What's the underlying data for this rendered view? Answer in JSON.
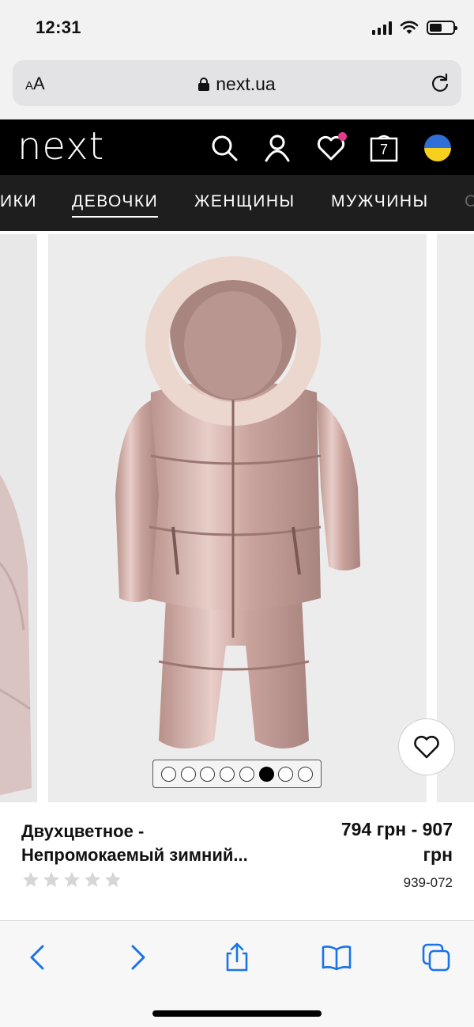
{
  "status_bar": {
    "time": "12:31"
  },
  "browser": {
    "text_size_label": "AA",
    "url": "next.ua"
  },
  "site": {
    "logo": "next",
    "cart_count": "7"
  },
  "nav": {
    "items": [
      {
        "label": "ИКИ",
        "active": false
      },
      {
        "label": "ДЕВОЧКИ",
        "active": true
      },
      {
        "label": "ЖЕНЩИНЫ",
        "active": false
      },
      {
        "label": "МУЖЧИНЫ",
        "active": false
      },
      {
        "label": "С",
        "active": false
      }
    ]
  },
  "gallery": {
    "dot_count": 8,
    "active_dot": 6
  },
  "product": {
    "title_line1": "Двухцветное -",
    "title_line2": "Непромокаемый зимний...",
    "price_line1": "794 грн - 907",
    "price_line2": "грн",
    "code": "939-072",
    "rating": 0,
    "rating_max": 5
  },
  "colors": {
    "header_bg": "#000000",
    "nav_bg": "#1e1e1e",
    "wishlist_dot": "#e03c8a",
    "toolbar_icons": "#1a73e8"
  }
}
